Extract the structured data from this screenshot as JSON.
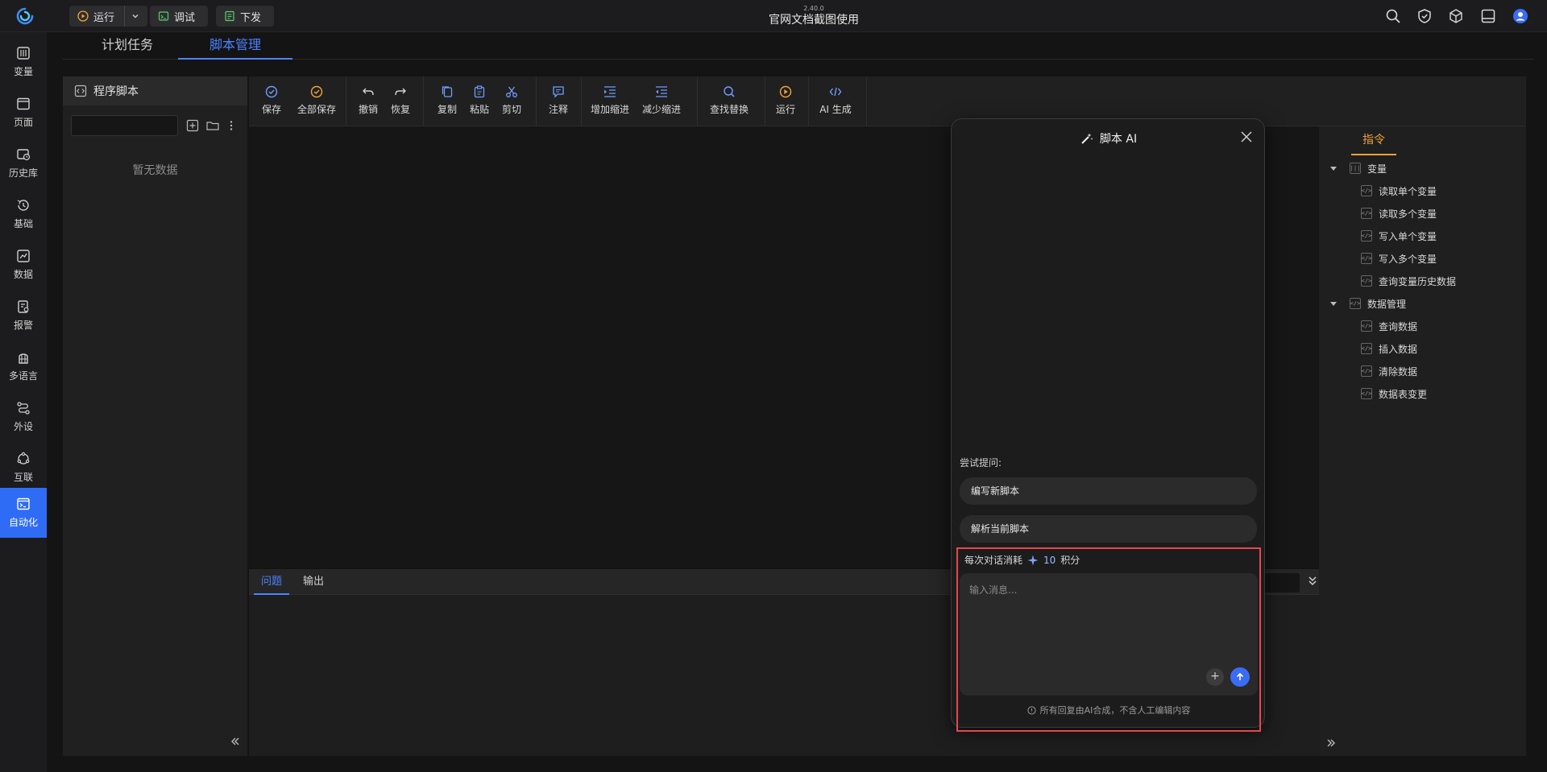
{
  "titlebar": {
    "version": "2.40.0",
    "title": "官网文档截图使用",
    "run_label": "运行",
    "debug_label": "调试",
    "deploy_label": "下发"
  },
  "nav": {
    "items": [
      {
        "label": "变量",
        "icon": "variable-icon"
      },
      {
        "label": "页面",
        "icon": "page-icon"
      },
      {
        "label": "历史库",
        "icon": "history-db-icon"
      },
      {
        "label": "基础",
        "icon": "basic-icon"
      },
      {
        "label": "数据",
        "icon": "data-icon"
      },
      {
        "label": "报警",
        "icon": "alarm-icon"
      },
      {
        "label": "多语言",
        "icon": "language-icon"
      },
      {
        "label": "外设",
        "icon": "peripheral-icon"
      },
      {
        "label": "互联",
        "icon": "interconnect-icon"
      },
      {
        "label": "自动化",
        "icon": "automation-icon"
      }
    ],
    "active": "自动化"
  },
  "tabs": [
    "计划任务",
    "脚本管理"
  ],
  "active_tab": "脚本管理",
  "script_panel": {
    "title": "程序脚本",
    "empty": "暂无数据"
  },
  "toolbar": {
    "save": "保存",
    "save_all": "全部保存",
    "undo": "撤销",
    "redo": "恢复",
    "copy": "复制",
    "paste": "粘贴",
    "cut": "剪切",
    "comment": "注释",
    "indent": "增加缩进",
    "outdent": "减少缩进",
    "find_replace": "查找替换",
    "run": "运行",
    "ai_generate": "AI 生成"
  },
  "bottom": {
    "tabs": [
      "问题",
      "输出"
    ]
  },
  "commands": {
    "tab": "指令",
    "groups": [
      {
        "label": "变量",
        "items": [
          "读取单个变量",
          "读取多个变量",
          "写入单个变量",
          "写入多个变量",
          "查询变量历史数据"
        ]
      },
      {
        "label": "数据管理",
        "items": [
          "查询数据",
          "插入数据",
          "清除数据",
          "数据表变更"
        ]
      }
    ]
  },
  "ai": {
    "title": "脚本 AI",
    "try_label": "尝试提问:",
    "suggestions": [
      "编写新脚本",
      "解析当前脚本"
    ],
    "cost_prefix": "每次对话消耗",
    "cost_value": "10",
    "cost_suffix": "积分",
    "placeholder": "输入消息...",
    "disclaimer": "所有回复由AI合成，不含人工编辑内容"
  },
  "colors": {
    "accent": "#2f6cf6",
    "commands_tab": "#f0a33a",
    "highlight_border": "#e5484d"
  }
}
